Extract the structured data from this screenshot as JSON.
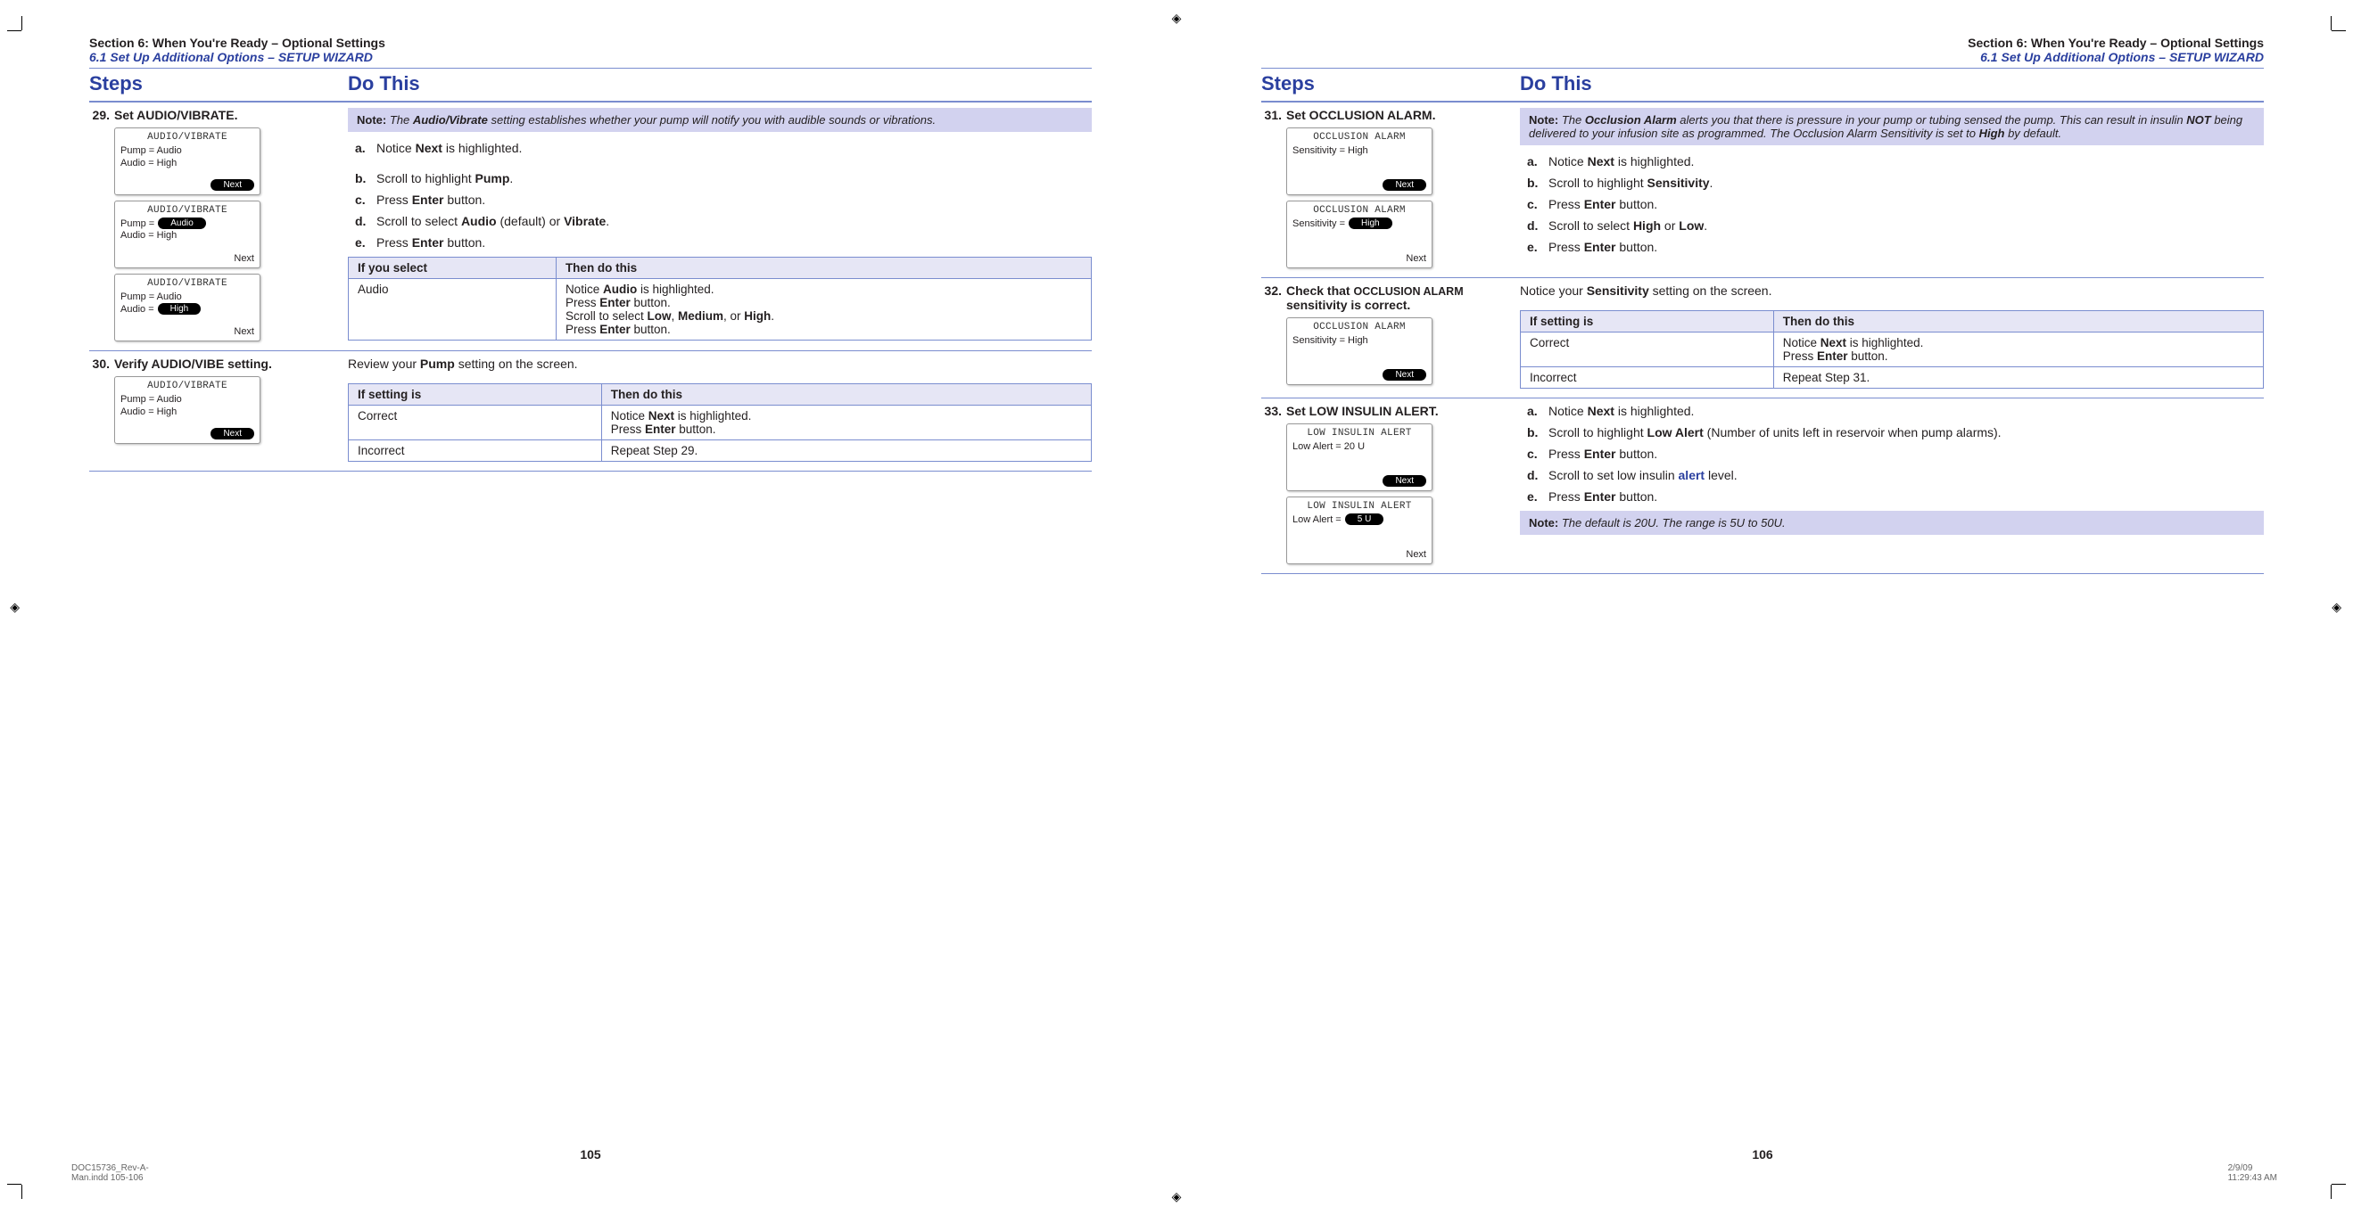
{
  "header": {
    "section": "Section 6: When You're Ready – Optional Settings",
    "sub": "6.1 Set Up Additional Options – SETUP WIZARD"
  },
  "cols": {
    "steps": "Steps",
    "do": "Do This"
  },
  "p105": {
    "num": "105",
    "s29": {
      "num": "29.",
      "title": "Set AUDIO/VIBRATE.",
      "scr1": {
        "t": "AUDIO/VIBRATE",
        "l1": "Pump = Audio",
        "l2": "Audio = High",
        "btn": "Next"
      },
      "scr2": {
        "t": "AUDIO/VIBRATE",
        "pfx": "Pump =",
        "pill": "Audio",
        "l2": "Audio = High",
        "btn": "Next"
      },
      "scr3": {
        "t": "AUDIO/VIBRATE",
        "l1": "Pump = Audio",
        "pfx": "Audio =",
        "pill": "High",
        "btn": "Next"
      },
      "note": {
        "p": "Note:",
        "t1": " The ",
        "b1": "Audio/Vibrate",
        "t2": " setting establishes whether your pump will notify you with audible sounds or vibrations."
      },
      "a": {
        "m": "a.",
        "t1": "Notice ",
        "b": "Next",
        "t2": " is highlighted."
      },
      "b": {
        "m": "b.",
        "t1": "Scroll to highlight ",
        "b": "Pump",
        "t2": "."
      },
      "c": {
        "m": "c.",
        "t1": "Press ",
        "b": "Enter",
        "t2": " button."
      },
      "d": {
        "m": "d.",
        "t1": "Scroll to select ",
        "b": "Audio",
        "t2": " (default) or ",
        "b2": "Vibrate",
        "t3": "."
      },
      "e": {
        "m": "e.",
        "t1": "Press ",
        "b": "Enter",
        "t2": " button."
      },
      "tbl": {
        "h1": "If you select",
        "h2": "Then do this",
        "r1c1": "Audio",
        "r1l1a": "Notice ",
        "r1l1b": "Audio",
        "r1l1c": " is highlighted.",
        "r1l2a": "Press ",
        "r1l2b": "Enter",
        "r1l2c": " button.",
        "r1l3a": "Scroll to select ",
        "r1l3b": "Low",
        "r1l3c": ", ",
        "r1l3d": "Medium",
        "r1l3e": ", or ",
        "r1l3f": "High",
        "r1l3g": ".",
        "r1l4a": "Press ",
        "r1l4b": "Enter",
        "r1l4c": " button."
      }
    },
    "s30": {
      "num": "30.",
      "title": "Verify AUDIO/VIBE setting.",
      "scr": {
        "t": "AUDIO/VIBRATE",
        "l1": "Pump = Audio",
        "l2": "Audio = High",
        "btn": "Next"
      },
      "intro1": "Review your ",
      "introB": "Pump",
      "intro2": " setting on the screen.",
      "tbl": {
        "h1": "If setting is",
        "h2": "Then do this",
        "r1c1": "Correct",
        "r1l1a": "Notice ",
        "r1l1b": "Next",
        "r1l1c": " is highlighted.",
        "r1l2a": "Press ",
        "r1l2b": "Enter",
        "r1l2c": " button.",
        "r2c1": "Incorrect",
        "r2c2": "Repeat Step 29."
      }
    }
  },
  "p106": {
    "num": "106",
    "s31": {
      "num": "31.",
      "title": "Set OCCLUSION ALARM.",
      "scr1": {
        "t": "OCCLUSION ALARM",
        "l1": "Sensitivity = High",
        "btn": "Next"
      },
      "scr2": {
        "t": "OCCLUSION ALARM",
        "pfx": "Sensitivity =",
        "pill": "High",
        "btn": "Next"
      },
      "note": {
        "p": "Note:",
        "t1": " The ",
        "b1": "Occlusion Alarm",
        "t2": " alerts you that there is pressure in your pump or tubing sensed the pump. This can result in insulin ",
        "b2": "NOT",
        "t3": " being delivered to your infusion site as programmed. The Occlusion Alarm Sensitivity is set to ",
        "b3": "High",
        "t4": " by default."
      },
      "a": {
        "m": "a.",
        "t1": "Notice ",
        "b": "Next",
        "t2": " is highlighted."
      },
      "b": {
        "m": "b.",
        "t1": "Scroll to highlight ",
        "b": "Sensitivity",
        "t2": "."
      },
      "c": {
        "m": "c.",
        "t1": "Press ",
        "b": "Enter",
        "t2": " button."
      },
      "d": {
        "m": "d.",
        "t1": "Scroll to select ",
        "b": "High",
        "t2": " or ",
        "b2": "Low",
        "t3": "."
      },
      "e": {
        "m": "e.",
        "t1": "Press ",
        "b": "Enter",
        "t2": " button."
      }
    },
    "s32": {
      "num": "32.",
      "title1": "Check that ",
      "titleSC": "OCCLUSION ALARM",
      "title2": " sensitivity is correct.",
      "scr": {
        "t": "OCCLUSION ALARM",
        "l1": "Sensitivity = High",
        "btn": "Next"
      },
      "intro1": "Notice your ",
      "introB": "Sensitivity",
      "intro2": " setting on the screen.",
      "tbl": {
        "h1": "If setting is",
        "h2": "Then do this",
        "r1c1": "Correct",
        "r1l1a": "Notice ",
        "r1l1b": "Next",
        "r1l1c": " is highlighted.",
        "r1l2a": "Press ",
        "r1l2b": "Enter",
        "r1l2c": " button.",
        "r2c1": "Incorrect",
        "r2c2": "Repeat Step 31."
      }
    },
    "s33": {
      "num": "33.",
      "title": "Set LOW INSULIN ALERT.",
      "scr1": {
        "t": "LOW INSULIN ALERT",
        "l1": "Low Alert = 20 U",
        "btn": "Next"
      },
      "scr2": {
        "t": "LOW INSULIN ALERT",
        "pfx": "Low Alert =",
        "pill": "5 U",
        "btn": "Next"
      },
      "a": {
        "m": "a.",
        "t1": "Notice ",
        "b": "Next",
        "t2": " is highlighted."
      },
      "b": {
        "m": "b.",
        "t1": "Scroll to highlight ",
        "b": "Low Alert",
        "t2": " (Number of units left in reservoir when pump alarms)."
      },
      "c": {
        "m": "c.",
        "t1": "Press ",
        "b": "Enter",
        "t2": " button."
      },
      "d": {
        "m": "d.",
        "t1": "Scroll to set low insulin ",
        "blue": "alert",
        "t2": " level."
      },
      "e": {
        "m": "e.",
        "t1": "Press ",
        "b": "Enter",
        "t2": " button."
      },
      "note2": {
        "p": "Note:",
        "t": " The default is 20U. The range is 5U to 50U."
      }
    }
  },
  "footer": {
    "left": "DOC15736_Rev-A-Man.indd   105-106",
    "right": "2/9/09   11:29:43 AM"
  }
}
